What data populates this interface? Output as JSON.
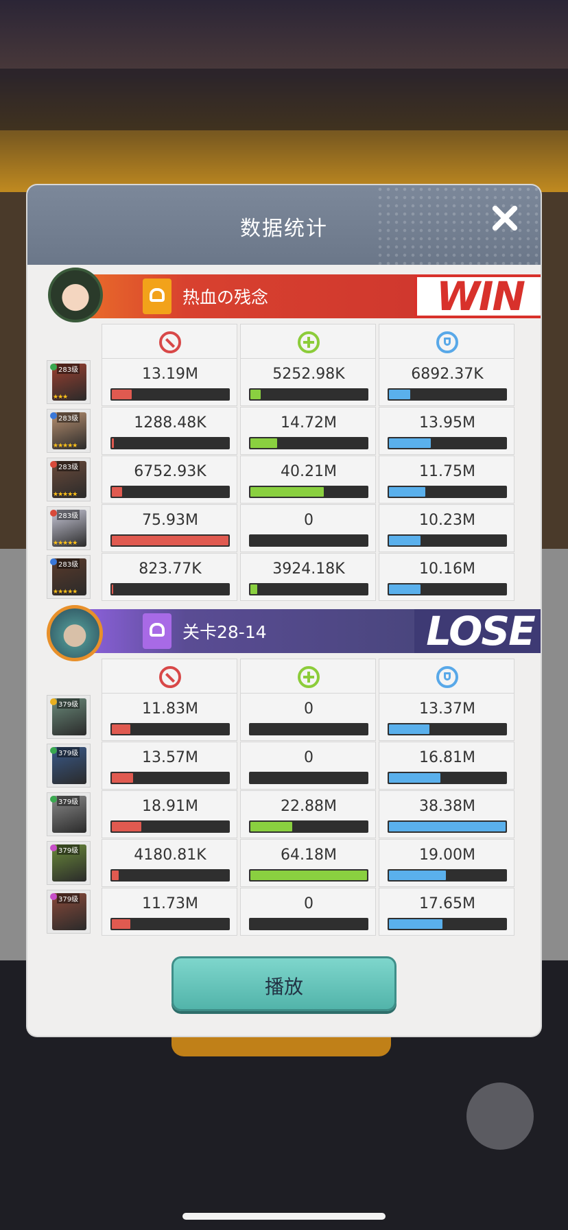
{
  "modal": {
    "title": "数据统计"
  },
  "teams": [
    {
      "name": "热血の残念",
      "result": "WIN",
      "heroes": [
        {
          "level": "283级",
          "stars": "★★★",
          "element_color": "#3aa850",
          "portrait_color": "#9a4030",
          "damage": {
            "text": "13.19M",
            "fill": 0.17
          },
          "heal": {
            "text": "5252.98K",
            "fill": 0.09
          },
          "shield": {
            "text": "6892.37K",
            "fill": 0.18
          }
        },
        {
          "level": "283级",
          "stars": "★★★★★",
          "element_color": "#3a78d8",
          "portrait_color": "#b89070",
          "damage": {
            "text": "1288.48K",
            "fill": 0.02
          },
          "heal": {
            "text": "14.72M",
            "fill": 0.23
          },
          "shield": {
            "text": "13.95M",
            "fill": 0.36
          }
        },
        {
          "level": "283级",
          "stars": "★★★★★",
          "element_color": "#d84a3a",
          "portrait_color": "#6a4a3a",
          "damage": {
            "text": "6752.93K",
            "fill": 0.09
          },
          "heal": {
            "text": "40.21M",
            "fill": 0.63
          },
          "shield": {
            "text": "11.75M",
            "fill": 0.31
          }
        },
        {
          "level": "283级",
          "stars": "★★★★★",
          "element_color": "#d84a3a",
          "portrait_color": "#c8c8d8",
          "damage": {
            "text": "75.93M",
            "fill": 1.0
          },
          "heal": {
            "text": "0",
            "fill": 0
          },
          "shield": {
            "text": "10.23M",
            "fill": 0.27
          }
        },
        {
          "level": "283级",
          "stars": "★★★★★",
          "element_color": "#3a78d8",
          "portrait_color": "#5a3a2a",
          "damage": {
            "text": "823.77K",
            "fill": 0.01
          },
          "heal": {
            "text": "3924.18K",
            "fill": 0.06
          },
          "shield": {
            "text": "10.16M",
            "fill": 0.27
          }
        }
      ]
    },
    {
      "name": "关卡28-14",
      "result": "LOSE",
      "heroes": [
        {
          "level": "379级",
          "stars": "",
          "element_color": "#e8b020",
          "portrait_color": "#6a8a7a",
          "damage": {
            "text": "11.83M",
            "fill": 0.16
          },
          "heal": {
            "text": "0",
            "fill": 0
          },
          "shield": {
            "text": "13.37M",
            "fill": 0.35
          }
        },
        {
          "level": "379级",
          "stars": "",
          "element_color": "#3aa850",
          "portrait_color": "#3a5a8a",
          "damage": {
            "text": "13.57M",
            "fill": 0.18
          },
          "heal": {
            "text": "0",
            "fill": 0
          },
          "shield": {
            "text": "16.81M",
            "fill": 0.44
          }
        },
        {
          "level": "379级",
          "stars": "",
          "element_color": "#3aa850",
          "portrait_color": "#8a8a8a",
          "damage": {
            "text": "18.91M",
            "fill": 0.25
          },
          "heal": {
            "text": "22.88M",
            "fill": 0.36
          },
          "shield": {
            "text": "38.38M",
            "fill": 1.0
          }
        },
        {
          "level": "379级",
          "stars": "",
          "element_color": "#c850c8",
          "portrait_color": "#6a8a3a",
          "damage": {
            "text": "4180.81K",
            "fill": 0.06
          },
          "heal": {
            "text": "64.18M",
            "fill": 1.0
          },
          "shield": {
            "text": "19.00M",
            "fill": 0.49
          }
        },
        {
          "level": "379级",
          "stars": "",
          "element_color": "#c850c8",
          "portrait_color": "#8a4a3a",
          "damage": {
            "text": "11.73M",
            "fill": 0.16
          },
          "heal": {
            "text": "0",
            "fill": 0
          },
          "shield": {
            "text": "17.65M",
            "fill": 0.46
          }
        }
      ]
    }
  ],
  "play_button": {
    "label": "播放"
  },
  "colors": {
    "damage": "#e05a50",
    "heal": "#8ad040",
    "shield": "#5ab0ec",
    "win": "#d8312b",
    "lose_bg": "#3e3a74"
  }
}
